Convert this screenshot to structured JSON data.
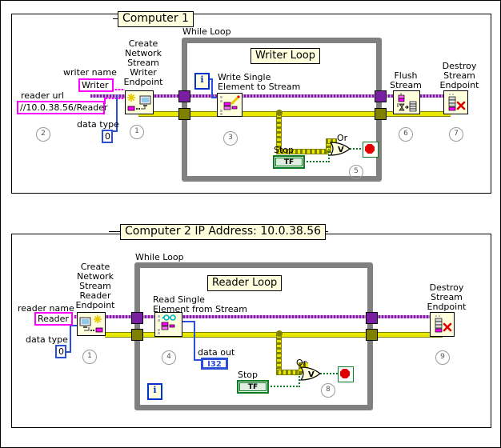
{
  "diagram": {
    "type": "labview-block-diagram",
    "title": "Network Stream Writer / Reader example"
  },
  "panels": [
    {
      "id": "computer1",
      "title": "Computer 1",
      "loop_label": "While Loop",
      "loop_title": "Writer Loop",
      "controls": [
        {
          "name": "writer name",
          "value": "Writer",
          "kind": "string"
        },
        {
          "name": "reader url",
          "value": "//10.0.38.56/Reader",
          "kind": "string"
        },
        {
          "name": "data type",
          "value": "0",
          "kind": "i32"
        }
      ],
      "nodes": [
        {
          "label": "Create\nNetwork\nStream\nWriter\nEndpoint",
          "step": "1",
          "icon": "create-writer-endpoint-icon"
        },
        {
          "label": "Write Single\nElement to Stream",
          "step": "3",
          "icon": "write-element-icon"
        },
        {
          "label": "Flush\nStream",
          "step": "6",
          "icon": "flush-stream-icon"
        },
        {
          "label": "Destroy\nStream\nEndpoint",
          "step": "7",
          "icon": "destroy-endpoint-icon"
        }
      ],
      "stop": {
        "label": "Stop",
        "value": "TF",
        "or_label": "Or",
        "step": "5"
      },
      "iteration_terminal": "i",
      "step_url": "2"
    },
    {
      "id": "computer2",
      "title": "Computer 2 IP Address: 10.0.38.56",
      "loop_label": "While Loop",
      "loop_title": "Reader Loop",
      "controls": [
        {
          "name": "reader name",
          "value": "Reader",
          "kind": "string"
        },
        {
          "name": "data type",
          "value": "0",
          "kind": "i32"
        }
      ],
      "indicators": [
        {
          "name": "data out",
          "value": "I32",
          "kind": "i32"
        }
      ],
      "nodes": [
        {
          "label": "Create\nNetwork\nStream\nReader\nEndpoint",
          "step": "1",
          "icon": "create-reader-endpoint-icon"
        },
        {
          "label": "Read Single\nElement from Stream",
          "step": "4",
          "icon": "read-element-icon"
        },
        {
          "label": "Destroy\nStream\nEndpoint",
          "step": "9",
          "icon": "destroy-endpoint-icon"
        }
      ],
      "stop": {
        "label": "Stop",
        "value": "TF",
        "or_label": "Or",
        "step": "8"
      },
      "iteration_terminal": "i"
    }
  ],
  "colors": {
    "node_fill": "#ffffdd",
    "loop_border": "#808080",
    "error_wire": "#7b1fa2",
    "data_wire": "#e8e800",
    "string_control": "#ff00ff",
    "numeric_control": "#2b4fd6",
    "boolean_control": "#0a7a23",
    "stop_sign": "#e00000"
  }
}
